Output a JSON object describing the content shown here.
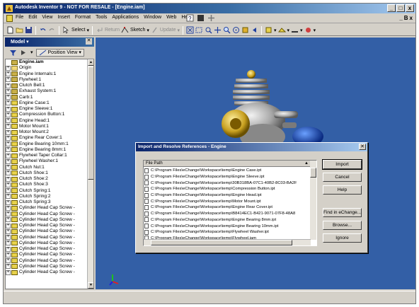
{
  "window": {
    "title": "Autodesk Inventor 9 - NOT FOR RESALE - [Engine.iam]",
    "controls": [
      "_",
      "□",
      "x"
    ]
  },
  "menubar": {
    "items": [
      "File",
      "Edit",
      "View",
      "Insert",
      "Format",
      "Tools",
      "Applications",
      "Window",
      "Web",
      "Help"
    ],
    "mdi_controls": [
      "_",
      "B",
      "x"
    ]
  },
  "toolbar": {
    "select_label": "Select",
    "return_label": "Return",
    "sketch_label": "Sketch",
    "update_label": "Update"
  },
  "browser": {
    "title": "Model",
    "view_label": "Position View",
    "items": [
      {
        "label": "Engine.iam",
        "type": "asm",
        "root": true
      },
      {
        "label": "Origin",
        "type": "folder"
      },
      {
        "label": "Engine Internals:1",
        "type": "asm"
      },
      {
        "label": "Flywheel:1",
        "type": "asm"
      },
      {
        "label": "Clutch Bell:1",
        "type": "asm"
      },
      {
        "label": "Exhaust System:1",
        "type": "asm"
      },
      {
        "label": "Carb:1",
        "type": "asm"
      },
      {
        "label": "Engine Case:1",
        "type": "part"
      },
      {
        "label": "Engine Sleeve:1",
        "type": "part"
      },
      {
        "label": "Compression Button:1",
        "type": "part"
      },
      {
        "label": "Engine Head:1",
        "type": "part"
      },
      {
        "label": "Motor Mount:1",
        "type": "part"
      },
      {
        "label": "Motor Mount:2",
        "type": "part"
      },
      {
        "label": "Engine Rear Cover:1",
        "type": "part"
      },
      {
        "label": "Engine Bearing 10mm:1",
        "type": "part"
      },
      {
        "label": "Engine Bearing 8mm:1",
        "type": "part"
      },
      {
        "label": "Flywheel Taper Collar:1",
        "type": "part"
      },
      {
        "label": "Flywheel Washer:1",
        "type": "part"
      },
      {
        "label": "Clutch Nut:1",
        "type": "part"
      },
      {
        "label": "Clutch Shoe:1",
        "type": "part"
      },
      {
        "label": "Clutch Shoe:2",
        "type": "part"
      },
      {
        "label": "Clutch Shoe:3",
        "type": "part"
      },
      {
        "label": "Clutch Spring:1",
        "type": "part"
      },
      {
        "label": "Clutch Spring:2",
        "type": "part"
      },
      {
        "label": "Clutch Spring:3",
        "type": "part"
      },
      {
        "label": "Cylinder Head Cap Screw -",
        "type": "part"
      },
      {
        "label": "Cylinder Head Cap Screw -",
        "type": "part"
      },
      {
        "label": "Cylinder Head Cap Screw -",
        "type": "part"
      },
      {
        "label": "Cylinder Head Cap Screw -",
        "type": "part"
      },
      {
        "label": "Cylinder Head Cap Screw -",
        "type": "part"
      },
      {
        "label": "Cylinder Head Cap Screw -",
        "type": "part"
      },
      {
        "label": "Cylinder Head Cap Screw -",
        "type": "part"
      },
      {
        "label": "Cylinder Head Cap Screw -",
        "type": "part"
      },
      {
        "label": "Cylinder Head Cap Screw -",
        "type": "part"
      },
      {
        "label": "Cylinder Head Cap Screw -",
        "type": "part"
      },
      {
        "label": "Cylinder Head Cap Screw -",
        "type": "part"
      },
      {
        "label": "Cylinder Head Cap Screw -",
        "type": "part"
      }
    ]
  },
  "dialog": {
    "title": "Import and Resolve References - Engine",
    "column_header": "File Path",
    "files": [
      "C:\\Program Files\\eChange\\Workspace\\temp\\Engine Case.ipt",
      "C:\\Program Files\\eChange\\Workspace\\temp\\Engine Sleeve.ipt",
      "C:\\Program Files\\eChange\\Workspace\\temp\\30B318BA-07C1-40B2-8C03-BA2F",
      "C:\\Program Files\\eChange\\Workspace\\temp\\Compression Button.ipt",
      "C:\\Program Files\\eChange\\Workspace\\temp\\Engine Head.ipt",
      "C:\\Program Files\\eChange\\Workspace\\temp\\Motor Mount.ipt",
      "C:\\Program Files\\eChange\\Workspace\\temp\\Engine Rear Cover.ipt",
      "C:\\Program Files\\eChange\\Workspace\\temp\\B8414EC1-B421-9071-07F8-48A8",
      "C:\\Program Files\\eChange\\Workspace\\temp\\Engine Bearing 8mm.ipt",
      "C:\\Program Files\\eChange\\Workspace\\temp\\Engine Bearing 10mm.ipt",
      "C:\\Program Files\\eChange\\Workspace\\temp\\Flywheel Washer.ipt",
      "C:\\Program Files\\eChange\\Workspace\\temp\\Flywheel.iam"
    ],
    "buttons": {
      "import": "Import",
      "cancel": "Cancel",
      "help": "Help",
      "find": "Find in eChange...",
      "browse": "Browse...",
      "ignore": "Ignore"
    }
  },
  "colors": {
    "titlebar": "#0a246a",
    "viewport_bg": "#335fa6",
    "chrome": "#d4d0c8"
  }
}
